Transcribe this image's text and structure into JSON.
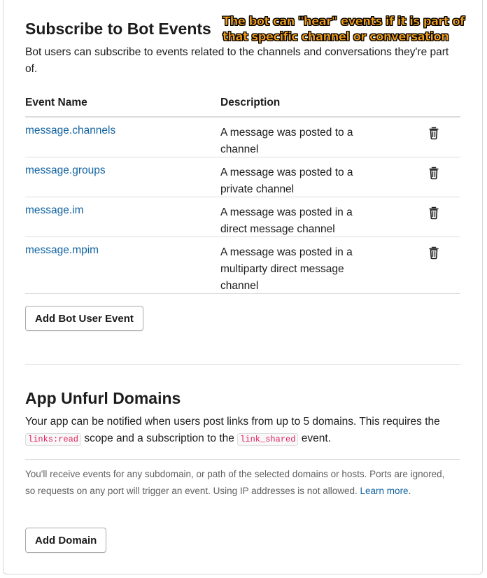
{
  "annotation": {
    "line1": "The bot can \"hear\" events if it is part of",
    "line2": "that specific channel or conversation",
    "color": "#f6a01a"
  },
  "bot_events": {
    "title": "Subscribe to Bot Events",
    "description": "Bot users can subscribe to events related to the channels and conversations they're part of.",
    "columns": [
      "Event Name",
      "Description"
    ],
    "rows": [
      {
        "name": "message.channels",
        "description": "A message was posted to a channel"
      },
      {
        "name": "message.groups",
        "description": "A message was posted to a private channel"
      },
      {
        "name": "message.im",
        "description": "A message was posted in a direct message channel"
      },
      {
        "name": "message.mpim",
        "description": "A message was posted in a multiparty direct message channel"
      }
    ],
    "delete_icon": "trash-icon",
    "add_button_label": "Add Bot User Event"
  },
  "unfurl": {
    "title": "App Unfurl Domains",
    "desc_part1": "Your app can be notified when users post links from up to 5 domains. This requires the",
    "code1": "links:read",
    "desc_part2": "scope and a subscription to the",
    "code2": "link_shared",
    "desc_part3": "event.",
    "note_text": "You'll receive events for any subdomain, or path of the selected domains or hosts. Ports are ignored, so requests on any port will trigger an event. Using IP addresses is not allowed.",
    "learn_more": "Learn more.",
    "add_button_label": "Add Domain"
  },
  "colors": {
    "link": "#1264a3",
    "text": "#1d1c1d",
    "muted": "#616061",
    "code": "#e01e5a",
    "border": "#dddddd"
  }
}
